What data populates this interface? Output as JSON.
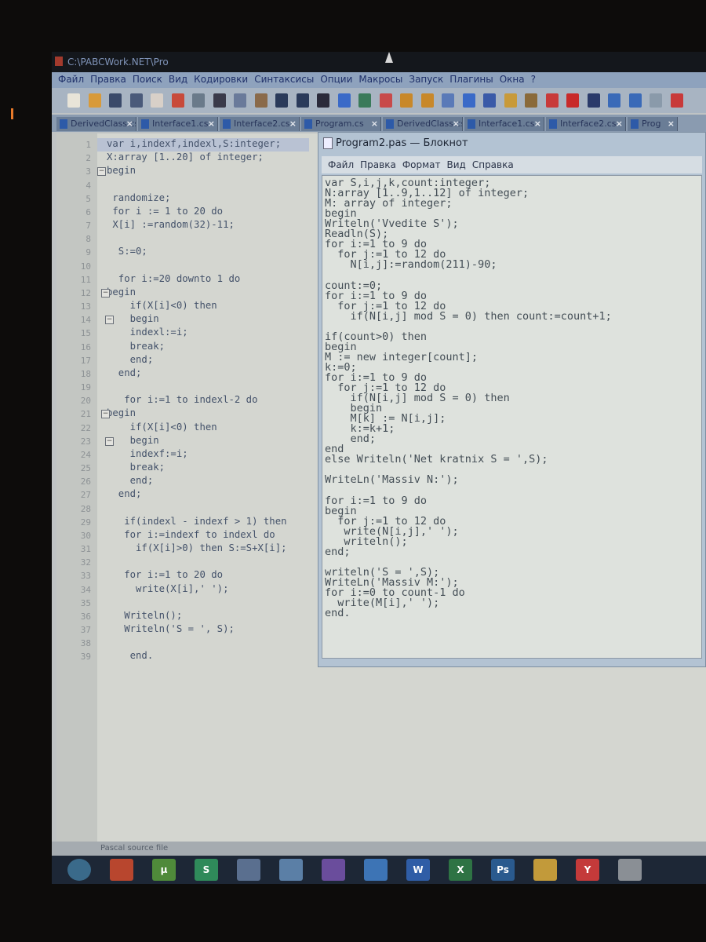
{
  "ide": {
    "title": "C:\\PABCWork.NET\\Pro",
    "menu": [
      "Файл",
      "Правка",
      "Поиск",
      "Вид",
      "Кодировки",
      "Синтаксисы",
      "Опции",
      "Макросы",
      "Запуск",
      "Плагины",
      "Окна",
      "?"
    ],
    "toolbar_icons": [
      "new-file",
      "open-file",
      "save",
      "save-all",
      "close",
      "close-all",
      "print",
      "cut",
      "copy",
      "paste",
      "undo",
      "redo",
      "find",
      "replace",
      "zoom-in",
      "zoom-out",
      "lock-1",
      "lock-2",
      "wrap",
      "paragraph",
      "view-1",
      "view-2",
      "view-3",
      "view-4",
      "record",
      "stop",
      "play",
      "play-fast",
      "save-macro",
      "spellcheck"
    ],
    "tabs": [
      "DerivedClass.cs",
      "Interface1.cs",
      "Interface2.cs",
      "Program.cs",
      "DerivedClass.cs",
      "Interface1.cs",
      "Interface2.cs",
      "Prog"
    ],
    "code_lines": [
      "var i,indexf,indexl,S:integer;",
      "X:array [1..20] of integer;",
      "begin",
      "",
      " randomize;",
      " for i := 1 to 20 do",
      " X[i] :=random(32)-11;",
      "",
      "  S:=0;",
      "",
      "  for i:=20 downto 1 do",
      "begin",
      "    if(X[i]<0) then",
      "    begin",
      "    indexl:=i;",
      "    break;",
      "    end;",
      "  end;",
      "",
      "   for i:=1 to indexl-2 do",
      "begin",
      "    if(X[i]<0) then",
      "    begin",
      "    indexf:=i;",
      "    break;",
      "    end;",
      "  end;",
      "",
      "   if(indexl - indexf > 1) then",
      "   for i:=indexf to indexl do",
      "     if(X[i]>0) then S:=S+X[i];",
      "",
      "   for i:=1 to 20 do",
      "     write(X[i],' ');",
      "",
      "   Writeln();",
      "   Writeln('S = ', S);",
      "",
      "    end."
    ],
    "status": "Pascal source file"
  },
  "notepad": {
    "title": "Program2.pas — Блокнот",
    "menu": [
      "Файл",
      "Правка",
      "Формат",
      "Вид",
      "Справка"
    ],
    "lines": [
      "var S,i,j,k,count:integer;",
      "N:array [1..9,1..12] of integer;",
      "M: array of integer;",
      "begin",
      "Writeln('Vvedite S');",
      "Readln(S);",
      "for i:=1 to 9 do",
      "  for j:=1 to 12 do",
      "    N[i,j]:=random(211)-90;",
      "",
      "count:=0;",
      "for i:=1 to 9 do",
      "  for j:=1 to 12 do",
      "    if(N[i,j] mod S = 0) then count:=count+1;",
      "",
      "if(count>0) then",
      "begin",
      "M := new integer[count];",
      "k:=0;",
      "for i:=1 to 9 do",
      "  for j:=1 to 12 do",
      "    if(N[i,j] mod S = 0) then",
      "    begin",
      "    M[k] := N[i,j];",
      "    k:=k+1;",
      "    end;",
      "end",
      "else Writeln('Net kratnix S = ',S);",
      "",
      "WriteLn('Massiv N:');",
      "",
      "for i:=1 to 9 do",
      "begin",
      "  for j:=1 to 12 do",
      "   write(N[i,j],' ');",
      "   writeln();",
      "end;",
      "",
      "writeln('S = ',S);",
      "WriteLn('Massiv M:');",
      "for i:=0 to count-1 do",
      "  write(M[i],' ');",
      "end."
    ]
  },
  "taskbar": {
    "apps": [
      {
        "name": "start",
        "label": "",
        "color": "#3a6a8a"
      },
      {
        "name": "media-player",
        "label": "",
        "color": "#b8462e"
      },
      {
        "name": "utorrent",
        "label": "µ",
        "color": "#4f8a3a"
      },
      {
        "name": "skype",
        "label": "S",
        "color": "#2f8a5a"
      },
      {
        "name": "python",
        "label": "",
        "color": "#5a6f8f"
      },
      {
        "name": "app-box",
        "label": "",
        "color": "#5b7fa6"
      },
      {
        "name": "visual-studio",
        "label": "",
        "color": "#6a4d9c"
      },
      {
        "name": "vs-code",
        "label": "",
        "color": "#3d74b5"
      },
      {
        "name": "word",
        "label": "W",
        "color": "#2f5da6"
      },
      {
        "name": "excel",
        "label": "X",
        "color": "#2e7344"
      },
      {
        "name": "photoshop",
        "label": "Ps",
        "color": "#2a5a8e"
      },
      {
        "name": "chrome",
        "label": "",
        "color": "#c29a3a"
      },
      {
        "name": "yandex-browser",
        "label": "Y",
        "color": "#c43a3a"
      },
      {
        "name": "unity",
        "label": "",
        "color": "#8a8f95"
      }
    ]
  }
}
